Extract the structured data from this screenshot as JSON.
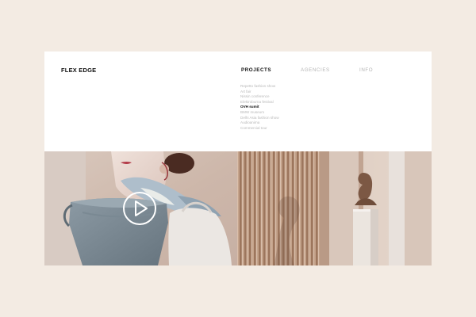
{
  "brand": {
    "logo_text": "FLEX EDGE"
  },
  "nav": {
    "items": [
      {
        "label": "PROJECTS",
        "active": true
      },
      {
        "label": "AGENCIES",
        "active": false
      },
      {
        "label": "INFO",
        "active": false
      }
    ]
  },
  "projects_menu": {
    "items": [
      {
        "label": "Repetto fashion show",
        "active": false
      },
      {
        "label": "Art fair",
        "active": false
      },
      {
        "label": "Nissin conference",
        "active": false
      },
      {
        "label": "Elektroburna festival",
        "active": false
      },
      {
        "label": "OVH sumit",
        "active": true
      },
      {
        "label": "BMW museum",
        "active": false
      },
      {
        "label": "Delhi Asia fashion show",
        "active": false
      },
      {
        "label": "Audioanima",
        "active": false
      },
      {
        "label": "Commercial tour",
        "active": false
      }
    ]
  },
  "hero": {
    "play_icon": "play-icon"
  },
  "colors": {
    "background": "#f3ebe3",
    "panel": "#ffffff",
    "text_active": "#111111",
    "text_inactive": "#b5b5b5"
  }
}
